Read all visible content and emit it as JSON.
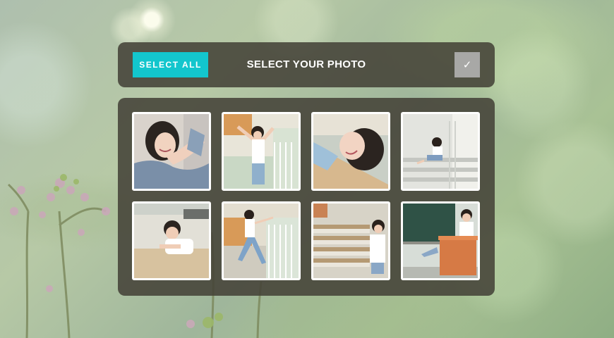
{
  "header": {
    "select_all_label": "SELECT ALL",
    "title": "SELECT YOUR PHOTO",
    "confirm_icon": "check-icon",
    "confirm_glyph": "✓"
  },
  "colors": {
    "accent": "#13c6cd",
    "panel": "#444238",
    "confirm_button": "#a8a8a6"
  },
  "photos": [
    {
      "subject": "girl-lying-on-arm"
    },
    {
      "subject": "girl-on-balcony-stretching"
    },
    {
      "subject": "girl-smiling-closeup"
    },
    {
      "subject": "girl-sitting-on-steps"
    },
    {
      "subject": "girl-at-desk-classroom"
    },
    {
      "subject": "girl-jumping-corridor"
    },
    {
      "subject": "girl-in-classroom-rows"
    },
    {
      "subject": "girl-at-blackboard-podium"
    }
  ]
}
